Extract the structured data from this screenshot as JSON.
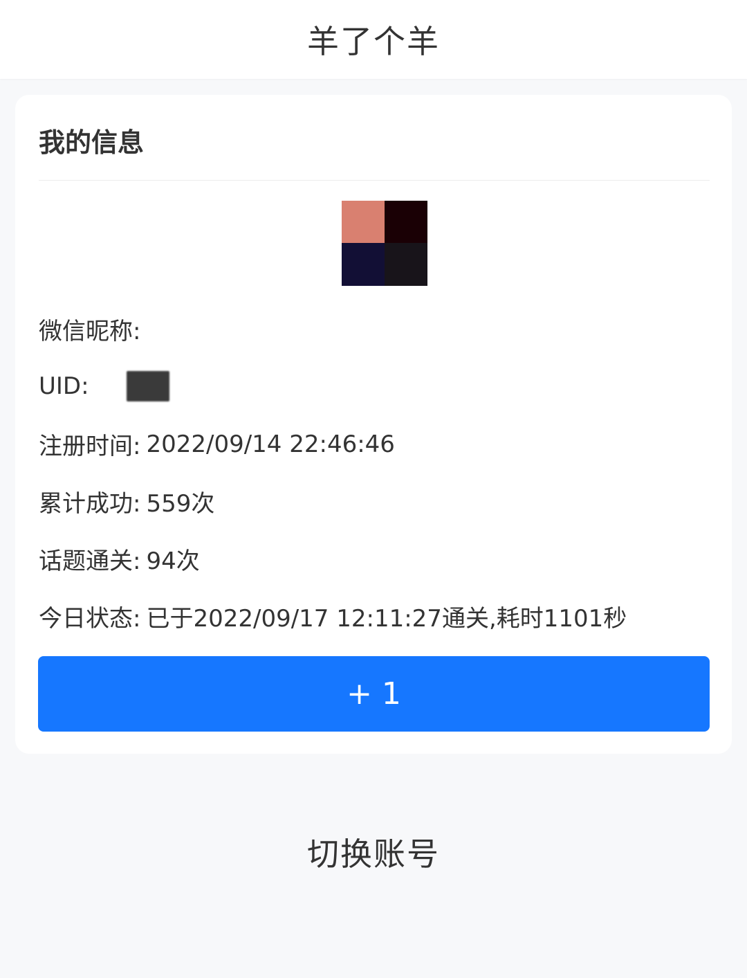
{
  "header": {
    "title": "羊了个羊"
  },
  "card": {
    "title": "我的信息",
    "avatar_colors": [
      "#d98070",
      "#1a0005",
      "#120f35",
      "#18141a"
    ],
    "fields": {
      "nickname_label": "微信昵称:",
      "nickname_value": "",
      "uid_label": "UID:",
      "register_label": "注册时间:",
      "register_value": "2022/09/14 22:46:46",
      "success_label": "累计成功:",
      "success_value": "559次",
      "topic_label": "话题通关:",
      "topic_value": "94次",
      "today_label": "今日状态:",
      "today_value": "已于2022/09/17 12:11:27通关,耗时1101秒"
    },
    "plus_button_label": "+ 1"
  },
  "footer": {
    "switch_account_label": "切换账号"
  },
  "colors": {
    "accent": "#1677ff",
    "page_bg": "#f7f8fa",
    "card_bg": "#ffffff",
    "text": "#333333"
  }
}
